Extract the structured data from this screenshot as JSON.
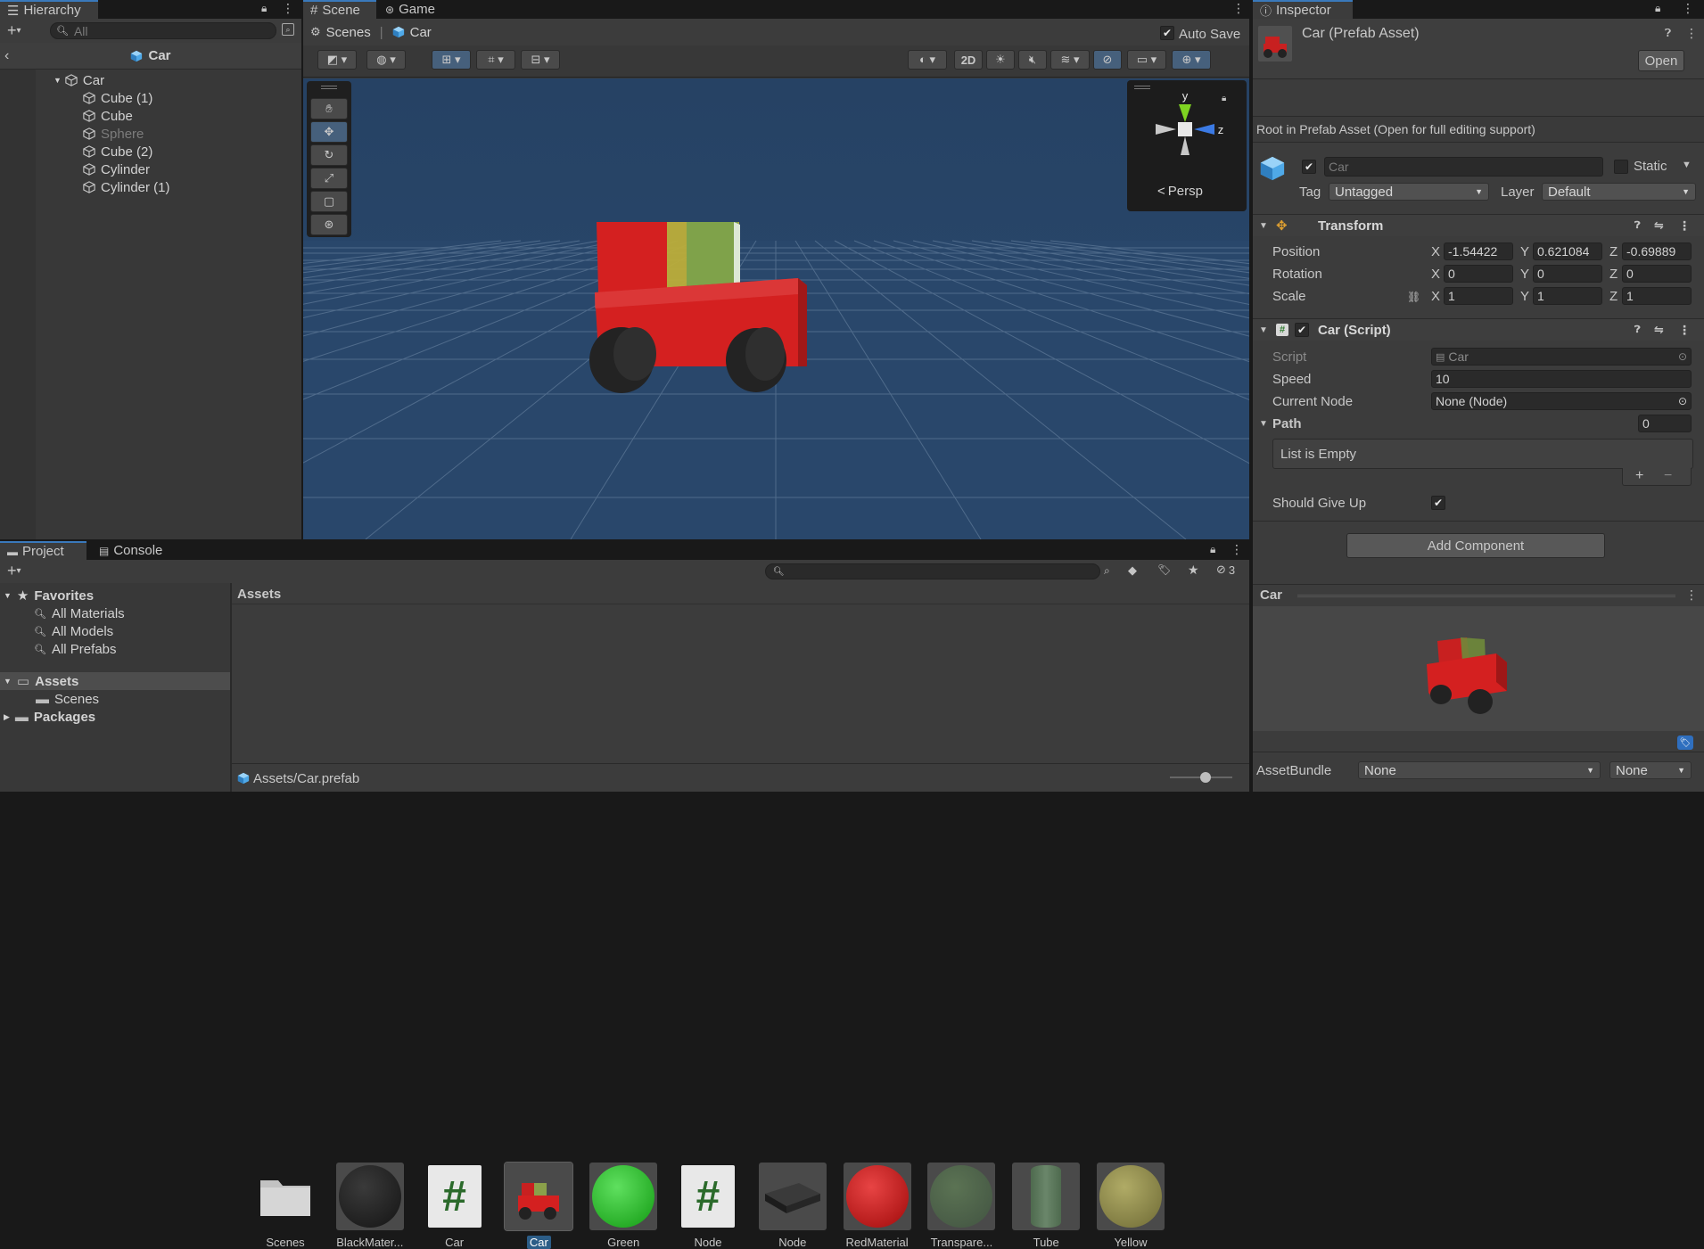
{
  "hierarchy": {
    "tab": "Hierarchy",
    "search_placeholder": "All",
    "prefab_title": "Car",
    "items": [
      {
        "label": "Car",
        "dim": false
      },
      {
        "label": "Cube (1)",
        "dim": false
      },
      {
        "label": "Cube",
        "dim": false
      },
      {
        "label": "Sphere",
        "dim": true
      },
      {
        "label": "Cube (2)",
        "dim": false
      },
      {
        "label": "Cylinder",
        "dim": false
      },
      {
        "label": "Cylinder (1)",
        "dim": false
      }
    ]
  },
  "scene": {
    "tabs": [
      "Scene",
      "Game"
    ],
    "breadcrumb": [
      "Scenes",
      "Car"
    ],
    "auto_save_label": "Auto Save",
    "auto_save_checked": true,
    "mode_2d": "2D",
    "gizmo_label": "Persp",
    "axis_y": "y",
    "axis_z": "z",
    "sky_color": "#264264",
    "car_color": "#d42020"
  },
  "inspector": {
    "tab": "Inspector",
    "asset_title": "Car (Prefab Asset)",
    "open_label": "Open",
    "root_note": "Root in Prefab Asset (Open for full editing support)",
    "name_value": "Car",
    "static_label": "Static",
    "tag_label": "Tag",
    "tag_value": "Untagged",
    "layer_label": "Layer",
    "layer_value": "Default",
    "transform": {
      "title": "Transform",
      "rows": [
        {
          "label": "Position",
          "x": "-1.54422",
          "y": "0.621084",
          "z": "-0.69889"
        },
        {
          "label": "Rotation",
          "x": "0",
          "y": "0",
          "z": "0"
        },
        {
          "label": "Scale",
          "x": "1",
          "y": "1",
          "z": "1"
        }
      ],
      "axis_x": "X",
      "axis_y": "Y",
      "axis_z": "Z"
    },
    "script_component": {
      "title": "Car (Script)",
      "script_label": "Script",
      "script_value": "Car",
      "speed_label": "Speed",
      "speed_value": "10",
      "node_label": "Current Node",
      "node_value": "None (Node)",
      "path_label": "Path",
      "path_count": "0",
      "list_empty": "List is Empty",
      "give_up_label": "Should Give Up",
      "give_up_checked": true
    },
    "add_component": "Add Component",
    "preview_title": "Car",
    "assetbundle_label": "AssetBundle",
    "assetbundle_value": "None",
    "assetbundle_variant": "None"
  },
  "project": {
    "tabs": [
      "Project",
      "Console"
    ],
    "hidden_count": "3",
    "favorites": {
      "label": "Favorites",
      "items": [
        "All Materials",
        "All Models",
        "All Prefabs"
      ]
    },
    "assets_label": "Assets",
    "scenes_label": "Scenes",
    "packages_label": "Packages",
    "breadcrumb": "Assets",
    "path": "Assets/Car.prefab",
    "assets": [
      {
        "name": "Scenes",
        "kind": "folder"
      },
      {
        "name": "BlackMater...",
        "kind": "black"
      },
      {
        "name": "Car",
        "kind": "script"
      },
      {
        "name": "Car",
        "kind": "prefab",
        "selected": true
      },
      {
        "name": "Green",
        "kind": "green"
      },
      {
        "name": "Node",
        "kind": "script"
      },
      {
        "name": "Node",
        "kind": "box"
      },
      {
        "name": "RedMaterial",
        "kind": "red"
      },
      {
        "name": "Transpare...",
        "kind": "trans"
      },
      {
        "name": "Tube",
        "kind": "tube"
      },
      {
        "name": "Yellow",
        "kind": "yellow"
      }
    ]
  }
}
